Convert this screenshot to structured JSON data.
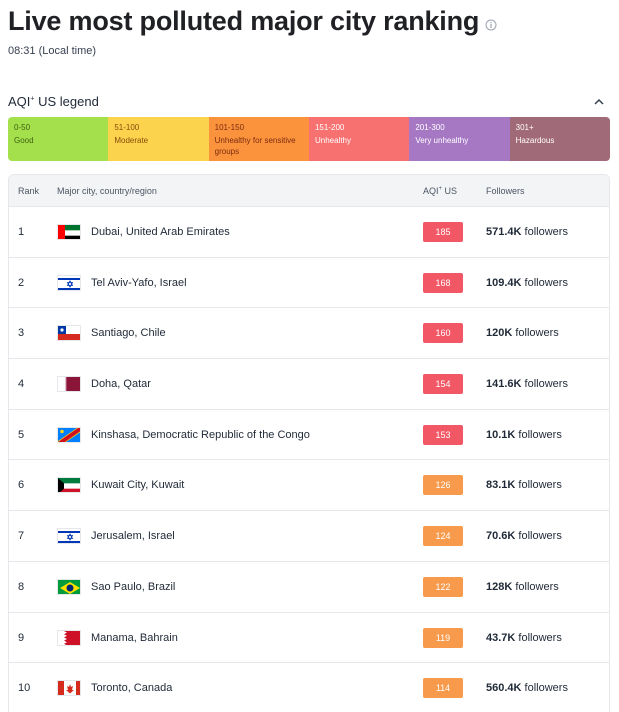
{
  "header": {
    "title": "Live most polluted major city ranking",
    "local_time": "08:31 (Local time)"
  },
  "legend": {
    "title": "AQI",
    "title_sup": "+",
    "title_suffix": " US legend",
    "segments": [
      {
        "range": "0-50",
        "label": "Good",
        "color": "#a3e04c",
        "text_color": "#3f6212"
      },
      {
        "range": "51-100",
        "label": "Moderate",
        "color": "#fcd34d",
        "text_color": "#854d0e"
      },
      {
        "range": "101-150",
        "label": "Unhealthy for sensitive groups",
        "color": "#fb923c",
        "text_color": "#7c2d12"
      },
      {
        "range": "151-200",
        "label": "Unhealthy",
        "color": "#f87171",
        "text_color": "#ffffff"
      },
      {
        "range": "201-300",
        "label": "Very unhealthy",
        "color": "#a678c4",
        "text_color": "#ffffff"
      },
      {
        "range": "301+",
        "label": "Hazardous",
        "color": "#a16a78",
        "text_color": "#ffffff"
      }
    ]
  },
  "table": {
    "headers": {
      "rank": "Rank",
      "city": "Major city, country/region",
      "aqi": "AQI",
      "aqi_sup": "+",
      "aqi_suffix": " US",
      "followers": "Followers"
    },
    "followers_suffix": " followers",
    "rows": [
      {
        "rank": "1",
        "flag": "uae-flag-icon",
        "city": "Dubai, United Arab Emirates",
        "aqi": "185",
        "aqi_color": "#f25766",
        "followers": "571.4K"
      },
      {
        "rank": "2",
        "flag": "israel-flag-icon",
        "city": "Tel Aviv-Yafo, Israel",
        "aqi": "168",
        "aqi_color": "#f25766",
        "followers": "109.4K"
      },
      {
        "rank": "3",
        "flag": "chile-flag-icon",
        "city": "Santiago, Chile",
        "aqi": "160",
        "aqi_color": "#f25766",
        "followers": "120K"
      },
      {
        "rank": "4",
        "flag": "qatar-flag-icon",
        "city": "Doha, Qatar",
        "aqi": "154",
        "aqi_color": "#f25766",
        "followers": "141.6K"
      },
      {
        "rank": "5",
        "flag": "drc-flag-icon",
        "city": "Kinshasa, Democratic Republic of the Congo",
        "aqi": "153",
        "aqi_color": "#f25766",
        "followers": "10.1K"
      },
      {
        "rank": "6",
        "flag": "kuwait-flag-icon",
        "city": "Kuwait City, Kuwait",
        "aqi": "126",
        "aqi_color": "#f89a4b",
        "followers": "83.1K"
      },
      {
        "rank": "7",
        "flag": "israel-flag-icon",
        "city": "Jerusalem, Israel",
        "aqi": "124",
        "aqi_color": "#f89a4b",
        "followers": "70.6K"
      },
      {
        "rank": "8",
        "flag": "brazil-flag-icon",
        "city": "Sao Paulo, Brazil",
        "aqi": "122",
        "aqi_color": "#f89a4b",
        "followers": "128K"
      },
      {
        "rank": "9",
        "flag": "bahrain-flag-icon",
        "city": "Manama, Bahrain",
        "aqi": "119",
        "aqi_color": "#f89a4b",
        "followers": "43.7K"
      },
      {
        "rank": "10",
        "flag": "canada-flag-icon",
        "city": "Toronto, Canada",
        "aqi": "114",
        "aqi_color": "#f89a4b",
        "followers": "560.4K"
      }
    ]
  }
}
